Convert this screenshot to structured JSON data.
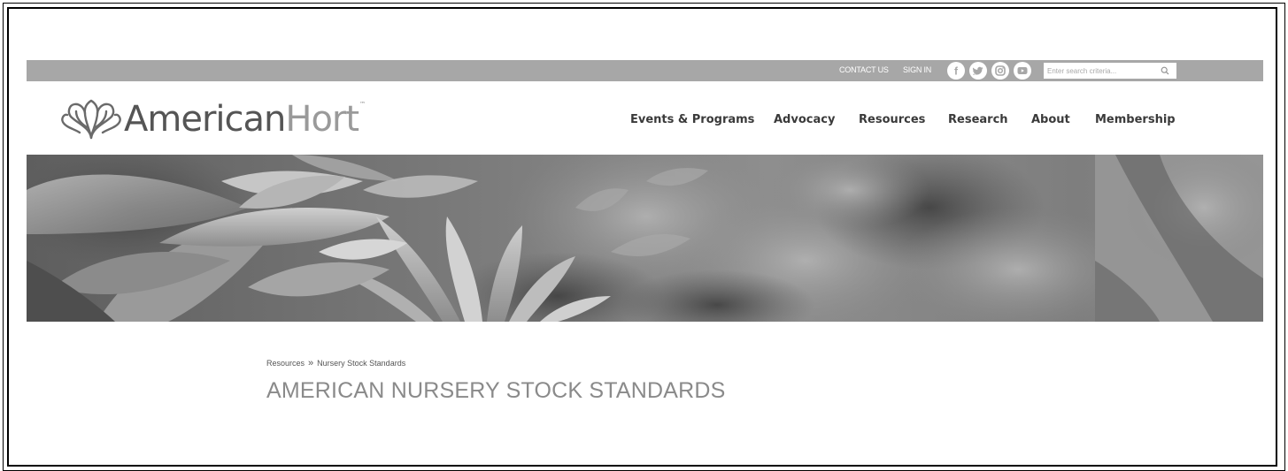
{
  "topbar": {
    "contact_label": "CONTACT US",
    "signin_label": "SIGN IN",
    "social": [
      {
        "icon": "facebook-icon",
        "glyph": "f"
      },
      {
        "icon": "twitter-icon"
      },
      {
        "icon": "instagram-icon"
      },
      {
        "icon": "youtube-icon"
      }
    ],
    "search": {
      "placeholder": "Enter search criteria...",
      "value": ""
    }
  },
  "logo": {
    "brand_dark": "American",
    "brand_light": "Hort",
    "tm": "™"
  },
  "nav": {
    "items": [
      {
        "label": "Events & Programs"
      },
      {
        "label": "Advocacy"
      },
      {
        "label": "Resources"
      },
      {
        "label": "Research"
      },
      {
        "label": "About"
      },
      {
        "label": "Membership"
      }
    ]
  },
  "breadcrumb": {
    "items": [
      {
        "label": "Resources"
      },
      {
        "label": "Nursery Stock Standards"
      }
    ],
    "separator": "»"
  },
  "page": {
    "title": "AMERICAN NURSERY STOCK STANDARDS"
  },
  "colors": {
    "topbar_bg": "#a7a7a7",
    "nav_text": "#3a3a3a",
    "title_text": "#8a8a8a"
  }
}
